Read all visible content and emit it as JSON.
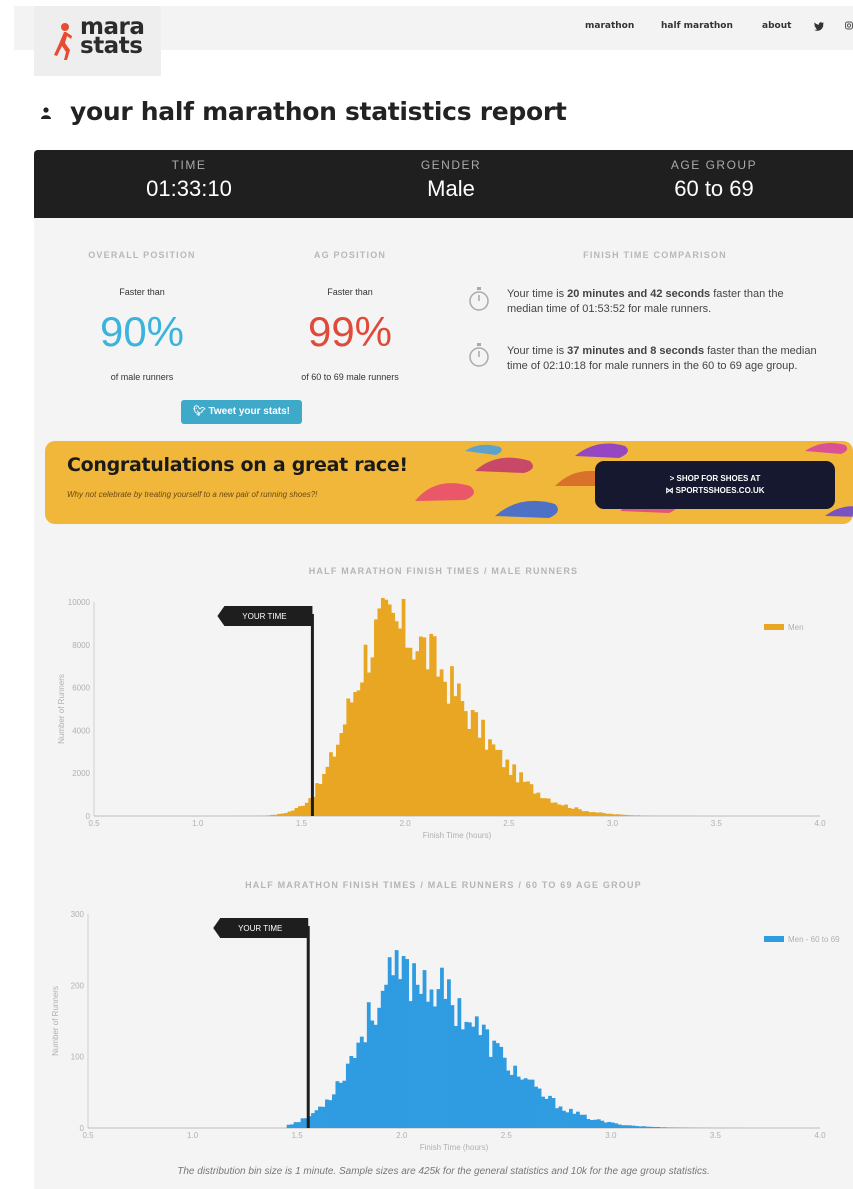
{
  "header": {
    "logo_line1": "mara",
    "logo_line2": "stats",
    "nav": [
      "marathon",
      "half marathon",
      "about"
    ],
    "social_icons": [
      "twitter-icon",
      "instagram-icon"
    ]
  },
  "page_title": "your half marathon statistics report",
  "summary": {
    "time_label": "TIME",
    "time_value": "01:33:10",
    "gender_label": "GENDER",
    "gender_value": "Male",
    "age_label": "AGE GROUP",
    "age_value": "60 to 69"
  },
  "stats": {
    "overall_heading": "OVERALL POSITION",
    "overall_faster": "Faster than",
    "overall_pct": "90%",
    "overall_sub": "of male runners",
    "ag_heading": "AG POSITION",
    "ag_faster": "Faster than",
    "ag_pct": "99%",
    "ag_sub": "of 60 to 69 male runners",
    "comparison_heading": "FINISH TIME COMPARISON",
    "tweet_label": "Tweet your stats!",
    "comparisons": [
      {
        "pre": "Your time is ",
        "bold": "20 minutes and 42 seconds",
        "post": " faster than the median time of 01:53:52 for male runners."
      },
      {
        "pre": "Your time is ",
        "bold": "37 minutes and 8 seconds",
        "post": " faster than the median time of 02:10:18 for male runners in the 60 to 69 age group."
      }
    ]
  },
  "banner": {
    "title": "Congratulations on a great race!",
    "subtitle": "Why not celebrate by treating yourself to a new pair of running shoes?!",
    "button_line1": "> SHOP FOR SHOES AT",
    "button_line2": "⋈ SPORTSSHOES.CO.UK"
  },
  "chart_data": [
    {
      "type": "bar",
      "title": "HALF MARATHON FINISH TIMES / MALE RUNNERS",
      "xlabel": "Finish Time (hours)",
      "ylabel": "Number of Runners",
      "xlim": [
        0.5,
        4.0
      ],
      "ylim": [
        0,
        10000
      ],
      "x_ticks": [
        "0.5",
        "1.0",
        "1.5",
        "2.0",
        "2.5",
        "3.0",
        "3.5",
        "4.0"
      ],
      "y_ticks": [
        "10000",
        "8000",
        "6000",
        "4000",
        "2000",
        "0"
      ],
      "legend": "top-right",
      "marker_label": "YOUR TIME",
      "marker_x": 1.553,
      "color": "#e8a623",
      "series": [
        {
          "name": "Men",
          "peak_x": 1.9,
          "peak_y": 8900,
          "sigma_left": 0.17,
          "sigma_right": 0.36,
          "start_x": 1.0,
          "end_x": 3.95
        }
      ]
    },
    {
      "type": "bar",
      "title": "HALF MARATHON FINISH TIMES / MALE RUNNERS / 60 TO 69 AGE GROUP",
      "xlabel": "Finish Time (hours)",
      "ylabel": "Number of Runners",
      "xlim": [
        0.5,
        4.0
      ],
      "ylim": [
        0,
        300
      ],
      "x_ticks": [
        "0.5",
        "1.0",
        "1.5",
        "2.0",
        "2.5",
        "3.0",
        "3.5",
        "4.0"
      ],
      "y_ticks": [
        "300",
        "200",
        "100",
        "0"
      ],
      "legend": "top-right",
      "marker_label": "YOUR TIME",
      "marker_x": 1.553,
      "color": "#2f9be0",
      "series": [
        {
          "name": "Men - 60 to 69",
          "peak_x": 2.0,
          "peak_y": 215,
          "sigma_left": 0.2,
          "sigma_right": 0.38,
          "start_x": 1.45,
          "end_x": 3.9
        }
      ]
    }
  ],
  "footnote": "The distribution bin size is 1 minute. Sample sizes are 425k for the general statistics and 10k for the age group statistics."
}
